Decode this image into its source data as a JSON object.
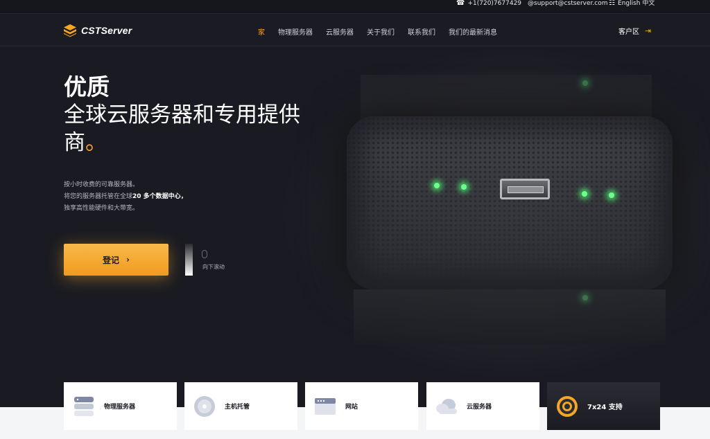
{
  "topbar": {
    "phone": "+1(720)7677429",
    "email": "@support@cstserver.com",
    "lang": "English 中文"
  },
  "nav": {
    "brand": "CSTServer",
    "menu": [
      {
        "label": "家",
        "active": true
      },
      {
        "label": "物理服务器",
        "active": false
      },
      {
        "label": "云服务器",
        "active": false
      },
      {
        "label": "关于我们",
        "active": false
      },
      {
        "label": "联系我们",
        "active": false
      },
      {
        "label": "我们的最新消息",
        "active": false
      }
    ],
    "client_area": "客户区"
  },
  "hero": {
    "title_bold": "优质",
    "title_line2": "全球云服务器和专用提供",
    "title_line3": "商",
    "title_dot": "。",
    "desc_line1": "按小时收费的可靠服务器。",
    "desc_line2_a": "将您的服务器托管在全球",
    "desc_line2_b": "20 多个数据中心",
    "desc_line2_c": "，",
    "desc_line3": "独享高性能硬件和大带宽。",
    "cta": "登记",
    "scroll_hint": "向下滚动"
  },
  "services": [
    {
      "label": "物理服务器",
      "icon": "server-stack-icon"
    },
    {
      "label": "主机托管",
      "icon": "disc-icon"
    },
    {
      "label": "网站",
      "icon": "browser-window-icon"
    },
    {
      "label": "云服务器",
      "icon": "cloud-icon"
    },
    {
      "label": "7x24 支持",
      "icon": "lifebuoy-icon"
    }
  ],
  "colors": {
    "accent": "#f5a623",
    "background": "#1a1b22",
    "nav": "#1b1c23"
  }
}
